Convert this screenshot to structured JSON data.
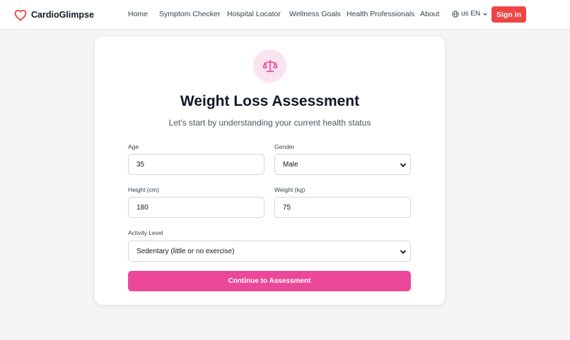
{
  "brand": {
    "name": "CardioGlimpse",
    "accent": "#ef4444"
  },
  "nav": {
    "items": [
      {
        "label": "Home"
      },
      {
        "label": "Symptom Checker"
      },
      {
        "label": "Hospital Locator"
      },
      {
        "label": "Wellness Goals"
      },
      {
        "label": "Health Professionals"
      },
      {
        "label": "About"
      }
    ],
    "language": "us EN",
    "signin_label": "Sign in"
  },
  "form": {
    "icon": "scale-icon",
    "title": "Weight Loss Assessment",
    "subtitle": "Let's start by understanding your current health status",
    "age": {
      "label": "Age",
      "value": "35"
    },
    "gender": {
      "label": "Gender",
      "value": "Male"
    },
    "height": {
      "label": "Height (cm)",
      "value": "180"
    },
    "weight": {
      "label": "Weight (kg)",
      "value": "75"
    },
    "activity": {
      "label": "Activity Level",
      "value": "Sedentary (little or no exercise)"
    },
    "submit_label": "Continue to Assessment",
    "submit_color": "#ec4899"
  }
}
